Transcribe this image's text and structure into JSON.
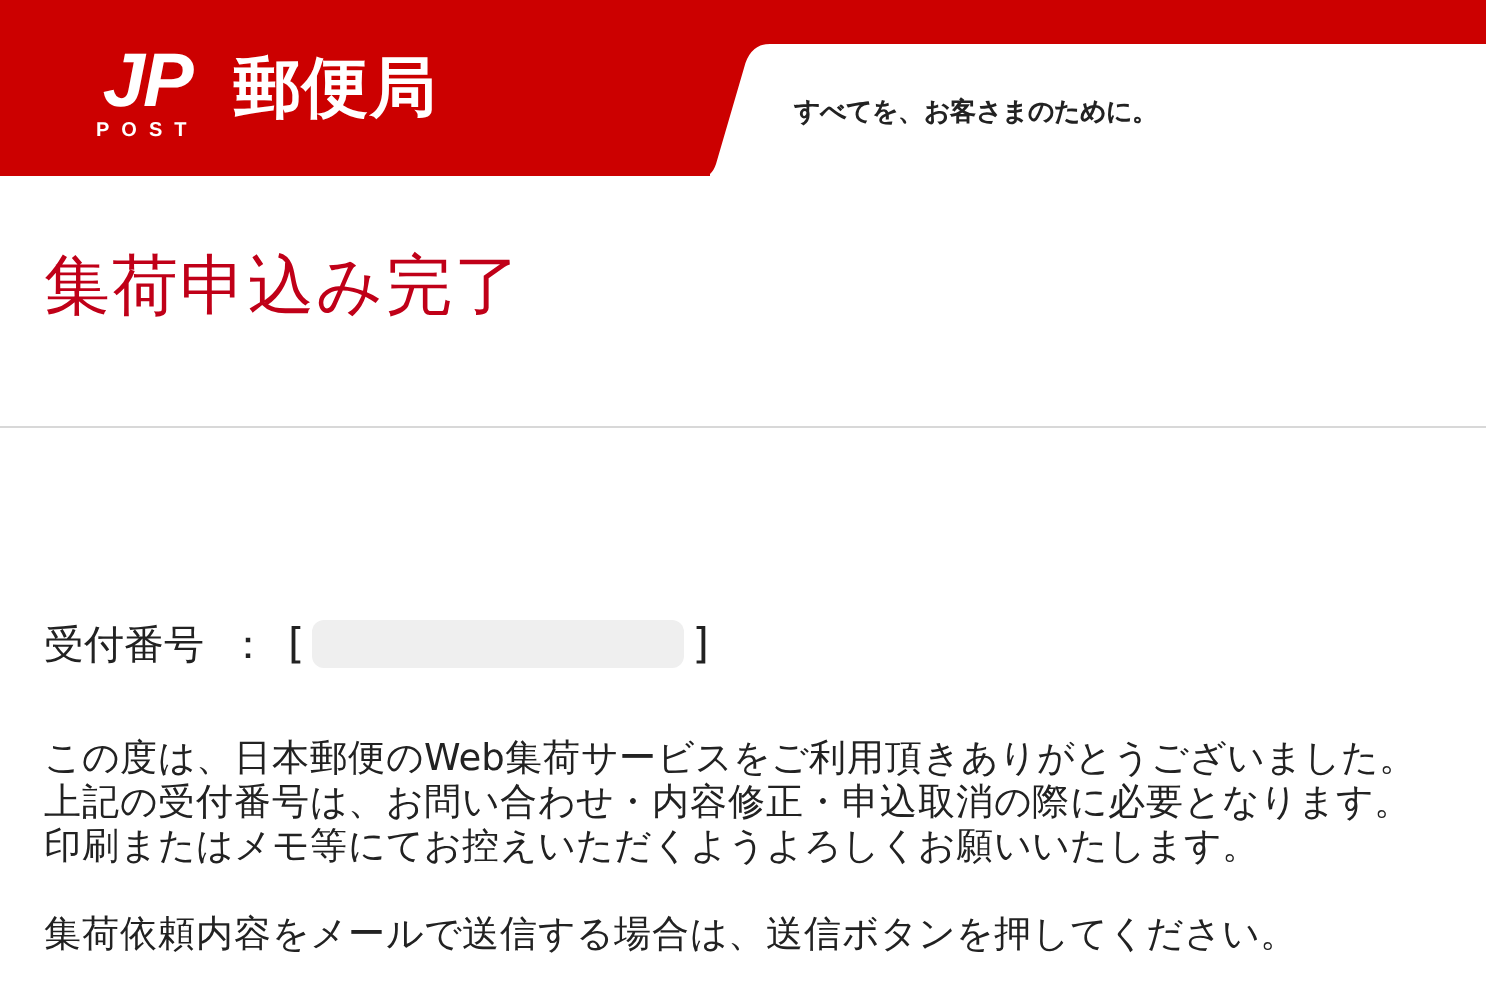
{
  "header": {
    "logo_mark": "JP",
    "logo_sub": "POST",
    "brand": "郵便局",
    "tagline": "すべてを、お客さまのために。"
  },
  "page_title": "集荷申込み完了",
  "receipt": {
    "label": "受付番号",
    "separator": "：",
    "open_bracket": "[",
    "close_bracket": "]",
    "value_redacted": true
  },
  "message_lines": [
    "この度は、日本郵便のWeb集荷サービスをご利用頂きありがとうございました。",
    "上記の受付番号は、お問い合わせ・内容修正・申込取消の際に必要となります。",
    "印刷またはメモ等にてお控えいただくようよろしくお願いいたします。"
  ],
  "mail_note": "集荷依頼内容をメールで送信する場合は、送信ボタンを押してください。"
}
